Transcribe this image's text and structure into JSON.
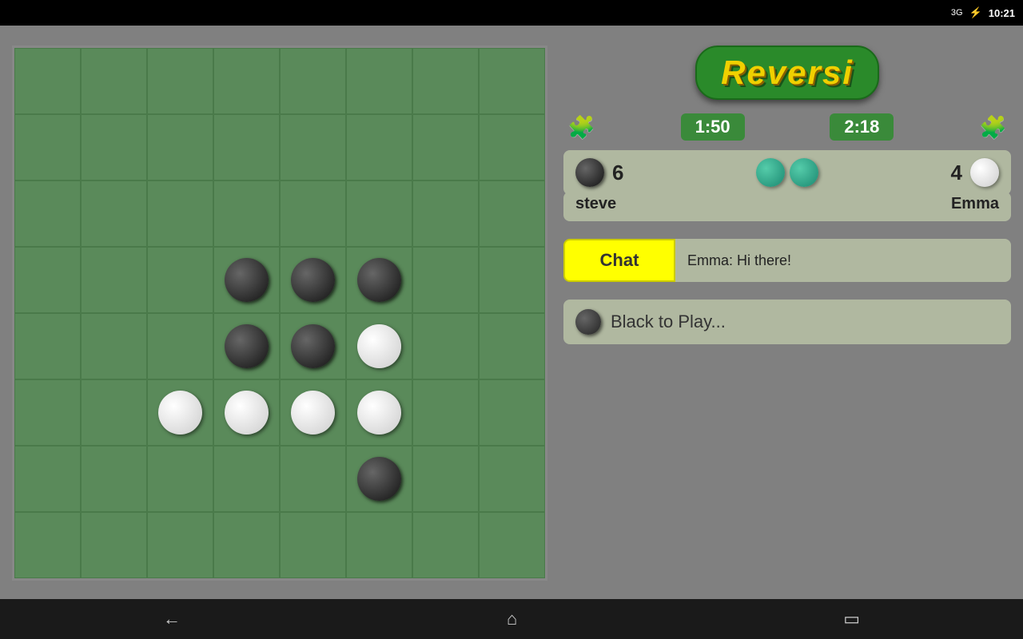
{
  "statusBar": {
    "network": "3G",
    "batteryIcon": "🔋",
    "time": "10:21"
  },
  "logo": {
    "text": "Reversi"
  },
  "timers": {
    "left": "1:50",
    "right": "2:18"
  },
  "scores": {
    "black": "6",
    "white": "4",
    "playerLeft": "steve",
    "playerRight": "Emma"
  },
  "chat": {
    "buttonLabel": "Chat",
    "message": "Emma: Hi there!"
  },
  "status": {
    "message": "Black to Play..."
  },
  "board": {
    "pieces": [
      {
        "row": 3,
        "col": 3,
        "color": "black"
      },
      {
        "row": 3,
        "col": 4,
        "color": "black"
      },
      {
        "row": 3,
        "col": 5,
        "color": "black"
      },
      {
        "row": 4,
        "col": 3,
        "color": "black"
      },
      {
        "row": 4,
        "col": 4,
        "color": "black"
      },
      {
        "row": 4,
        "col": 5,
        "color": "white"
      },
      {
        "row": 5,
        "col": 2,
        "color": "white"
      },
      {
        "row": 5,
        "col": 3,
        "color": "white"
      },
      {
        "row": 5,
        "col": 4,
        "color": "white"
      },
      {
        "row": 5,
        "col": 5,
        "color": "white"
      },
      {
        "row": 6,
        "col": 5,
        "color": "black"
      }
    ]
  },
  "nav": {
    "back": "←",
    "home": "⌂",
    "recent": "▭"
  }
}
